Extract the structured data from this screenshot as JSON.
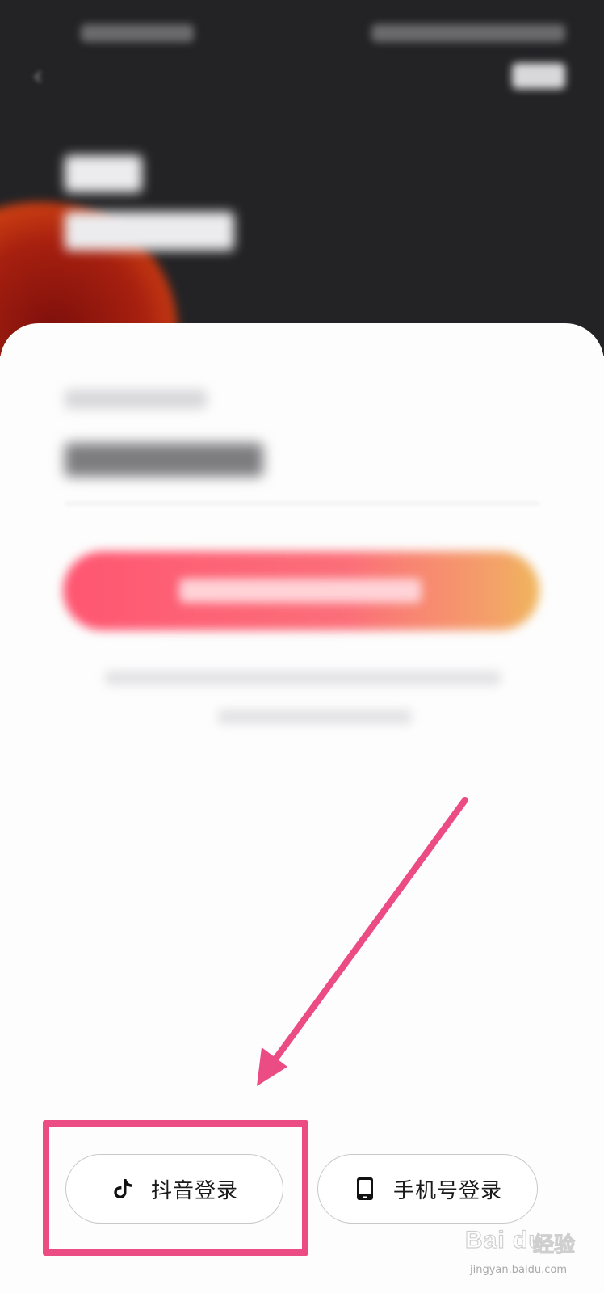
{
  "login_options": {
    "douyin": {
      "label": "抖音登录",
      "icon": "douyin-logo-icon"
    },
    "phone": {
      "label": "手机号登录",
      "icon": "smartphone-icon"
    }
  },
  "annotation": {
    "box_color": "#ec4c84",
    "arrow_color": "#ec4c84"
  },
  "theme": {
    "header_bg": "#232326",
    "primary_gradient": [
      "#ff5672",
      "#efb65c"
    ]
  },
  "watermark": {
    "logo_text": "Bai du",
    "brand_text": "经验",
    "url": "jingyan.baidu.com"
  }
}
